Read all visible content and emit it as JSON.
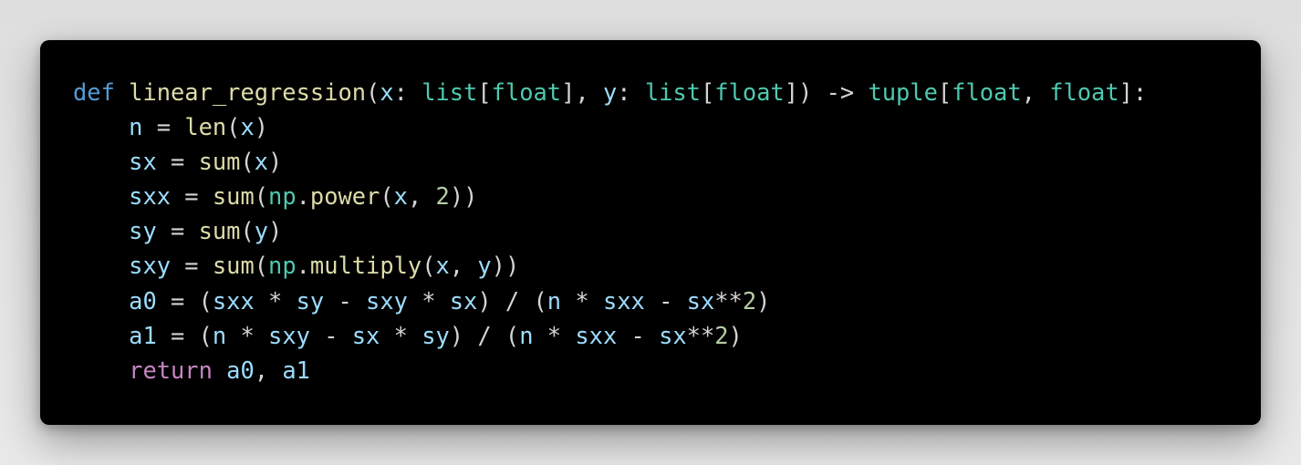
{
  "code": {
    "language": "python",
    "colors": {
      "background": "#000000",
      "page_background": "#e6e6e6",
      "keyword": "#569cd6",
      "control": "#c586c0",
      "function": "#dcdcaa",
      "variable": "#9cdcfe",
      "type": "#4ec9b0",
      "number": "#b5cea8",
      "punctuation": "#d4d4d4"
    },
    "lines": [
      [
        {
          "text": "def",
          "type": "keyword"
        },
        {
          "text": " ",
          "type": "plain"
        },
        {
          "text": "linear_regression",
          "type": "function"
        },
        {
          "text": "(",
          "type": "punct"
        },
        {
          "text": "x",
          "type": "variable"
        },
        {
          "text": ": ",
          "type": "punct"
        },
        {
          "text": "list",
          "type": "type"
        },
        {
          "text": "[",
          "type": "punct"
        },
        {
          "text": "float",
          "type": "type"
        },
        {
          "text": "], ",
          "type": "punct"
        },
        {
          "text": "y",
          "type": "variable"
        },
        {
          "text": ": ",
          "type": "punct"
        },
        {
          "text": "list",
          "type": "type"
        },
        {
          "text": "[",
          "type": "punct"
        },
        {
          "text": "float",
          "type": "type"
        },
        {
          "text": "]) -> ",
          "type": "punct"
        },
        {
          "text": "tuple",
          "type": "type"
        },
        {
          "text": "[",
          "type": "punct"
        },
        {
          "text": "float",
          "type": "type"
        },
        {
          "text": ", ",
          "type": "punct"
        },
        {
          "text": "float",
          "type": "type"
        },
        {
          "text": "]:",
          "type": "punct"
        }
      ],
      [
        {
          "text": "    ",
          "type": "plain"
        },
        {
          "text": "n",
          "type": "variable"
        },
        {
          "text": " = ",
          "type": "punct"
        },
        {
          "text": "len",
          "type": "function"
        },
        {
          "text": "(",
          "type": "punct"
        },
        {
          "text": "x",
          "type": "variable"
        },
        {
          "text": ")",
          "type": "punct"
        }
      ],
      [
        {
          "text": "    ",
          "type": "plain"
        },
        {
          "text": "sx",
          "type": "variable"
        },
        {
          "text": " = ",
          "type": "punct"
        },
        {
          "text": "sum",
          "type": "function"
        },
        {
          "text": "(",
          "type": "punct"
        },
        {
          "text": "x",
          "type": "variable"
        },
        {
          "text": ")",
          "type": "punct"
        }
      ],
      [
        {
          "text": "    ",
          "type": "plain"
        },
        {
          "text": "sxx",
          "type": "variable"
        },
        {
          "text": " = ",
          "type": "punct"
        },
        {
          "text": "sum",
          "type": "function"
        },
        {
          "text": "(",
          "type": "punct"
        },
        {
          "text": "np",
          "type": "type"
        },
        {
          "text": ".",
          "type": "punct"
        },
        {
          "text": "power",
          "type": "function"
        },
        {
          "text": "(",
          "type": "punct"
        },
        {
          "text": "x",
          "type": "variable"
        },
        {
          "text": ", ",
          "type": "punct"
        },
        {
          "text": "2",
          "type": "number"
        },
        {
          "text": "))",
          "type": "punct"
        }
      ],
      [
        {
          "text": "    ",
          "type": "plain"
        },
        {
          "text": "sy",
          "type": "variable"
        },
        {
          "text": " = ",
          "type": "punct"
        },
        {
          "text": "sum",
          "type": "function"
        },
        {
          "text": "(",
          "type": "punct"
        },
        {
          "text": "y",
          "type": "variable"
        },
        {
          "text": ")",
          "type": "punct"
        }
      ],
      [
        {
          "text": "    ",
          "type": "plain"
        },
        {
          "text": "sxy",
          "type": "variable"
        },
        {
          "text": " = ",
          "type": "punct"
        },
        {
          "text": "sum",
          "type": "function"
        },
        {
          "text": "(",
          "type": "punct"
        },
        {
          "text": "np",
          "type": "type"
        },
        {
          "text": ".",
          "type": "punct"
        },
        {
          "text": "multiply",
          "type": "function"
        },
        {
          "text": "(",
          "type": "punct"
        },
        {
          "text": "x",
          "type": "variable"
        },
        {
          "text": ", ",
          "type": "punct"
        },
        {
          "text": "y",
          "type": "variable"
        },
        {
          "text": "))",
          "type": "punct"
        }
      ],
      [
        {
          "text": "    ",
          "type": "plain"
        },
        {
          "text": "a0",
          "type": "variable"
        },
        {
          "text": " = (",
          "type": "punct"
        },
        {
          "text": "sxx",
          "type": "variable"
        },
        {
          "text": " * ",
          "type": "punct"
        },
        {
          "text": "sy",
          "type": "variable"
        },
        {
          "text": " - ",
          "type": "punct"
        },
        {
          "text": "sxy",
          "type": "variable"
        },
        {
          "text": " * ",
          "type": "punct"
        },
        {
          "text": "sx",
          "type": "variable"
        },
        {
          "text": ") / (",
          "type": "punct"
        },
        {
          "text": "n",
          "type": "variable"
        },
        {
          "text": " * ",
          "type": "punct"
        },
        {
          "text": "sxx",
          "type": "variable"
        },
        {
          "text": " - ",
          "type": "punct"
        },
        {
          "text": "sx",
          "type": "variable"
        },
        {
          "text": "**",
          "type": "punct"
        },
        {
          "text": "2",
          "type": "number"
        },
        {
          "text": ")",
          "type": "punct"
        }
      ],
      [
        {
          "text": "    ",
          "type": "plain"
        },
        {
          "text": "a1",
          "type": "variable"
        },
        {
          "text": " = (",
          "type": "punct"
        },
        {
          "text": "n",
          "type": "variable"
        },
        {
          "text": " * ",
          "type": "punct"
        },
        {
          "text": "sxy",
          "type": "variable"
        },
        {
          "text": " - ",
          "type": "punct"
        },
        {
          "text": "sx",
          "type": "variable"
        },
        {
          "text": " * ",
          "type": "punct"
        },
        {
          "text": "sy",
          "type": "variable"
        },
        {
          "text": ") / (",
          "type": "punct"
        },
        {
          "text": "n",
          "type": "variable"
        },
        {
          "text": " * ",
          "type": "punct"
        },
        {
          "text": "sxx",
          "type": "variable"
        },
        {
          "text": " - ",
          "type": "punct"
        },
        {
          "text": "sx",
          "type": "variable"
        },
        {
          "text": "**",
          "type": "punct"
        },
        {
          "text": "2",
          "type": "number"
        },
        {
          "text": ")",
          "type": "punct"
        }
      ],
      [
        {
          "text": "    ",
          "type": "plain"
        },
        {
          "text": "return",
          "type": "control"
        },
        {
          "text": " ",
          "type": "plain"
        },
        {
          "text": "a0",
          "type": "variable"
        },
        {
          "text": ", ",
          "type": "punct"
        },
        {
          "text": "a1",
          "type": "variable"
        }
      ]
    ]
  }
}
